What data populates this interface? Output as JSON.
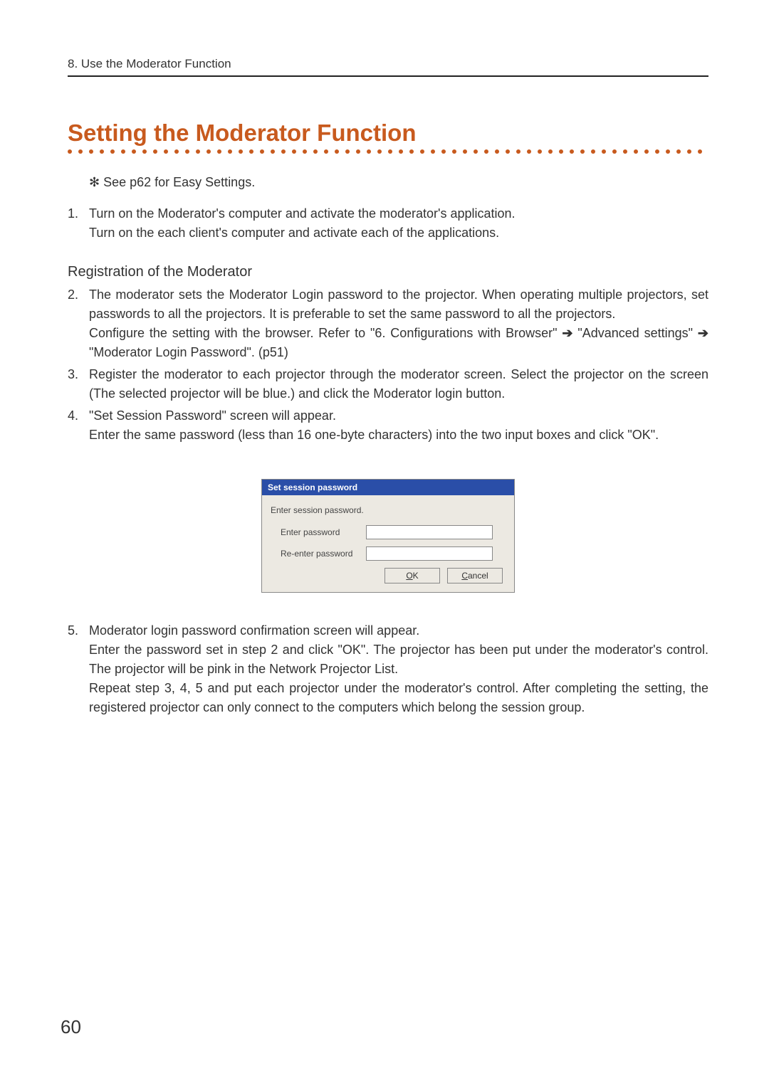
{
  "header": "8. Use the Moderator Function",
  "title": "Setting the Moderator Function",
  "note": "✻ See p62 for Easy Settings.",
  "step1": {
    "num": "1.",
    "line1": "Turn on the Moderator's computer and activate the moderator's application.",
    "line2": "Turn on the each client's computer and activate each of the applications."
  },
  "subheading": "Registration of the Moderator",
  "step2": {
    "num": "2.",
    "p1": "The moderator sets the Moderator Login password to the projector.  When operating multiple projectors, set passwords to all the projectors.  It is preferable to set the same password to all the projectors.",
    "p2a": "Configure the setting with the browser.  Refer to \"6. Configurations with Browser\" ",
    "p2arrow": "➔",
    "p2b": " \"Advanced settings\" ",
    "p2c": " \"Moderator Login Password\".  (p51)"
  },
  "step3": {
    "num": "3.",
    "text": "Register the moderator to each projector through the moderator screen.  Select the projector on the screen (The selected projector will be blue.) and click the Moderator login button."
  },
  "step4": {
    "num": "4.",
    "line1": "\"Set Session Password\" screen will appear.",
    "line2": "Enter the same password (less than 16 one-byte characters) into the two input boxes and click \"OK\"."
  },
  "dialog": {
    "title": "Set session password",
    "label": "Enter session password.",
    "row1": "Enter password",
    "row2": "Re-enter password",
    "ok_u": "O",
    "ok_rest": "K",
    "cancel_u": "C",
    "cancel_rest": "ancel"
  },
  "step5": {
    "num": "5.",
    "line1": "Moderator login password confirmation screen will appear.",
    "p1": "Enter the password set in step 2 and click \"OK\".  The projector has been put under the moderator's control.  The projector will be pink in the Network Projector List.",
    "p2": "Repeat step 3, 4, 5 and put each projector under the moderator's control.  After completing the setting, the registered projector can only connect to the computers which belong the session group."
  },
  "pageNumber": "60"
}
